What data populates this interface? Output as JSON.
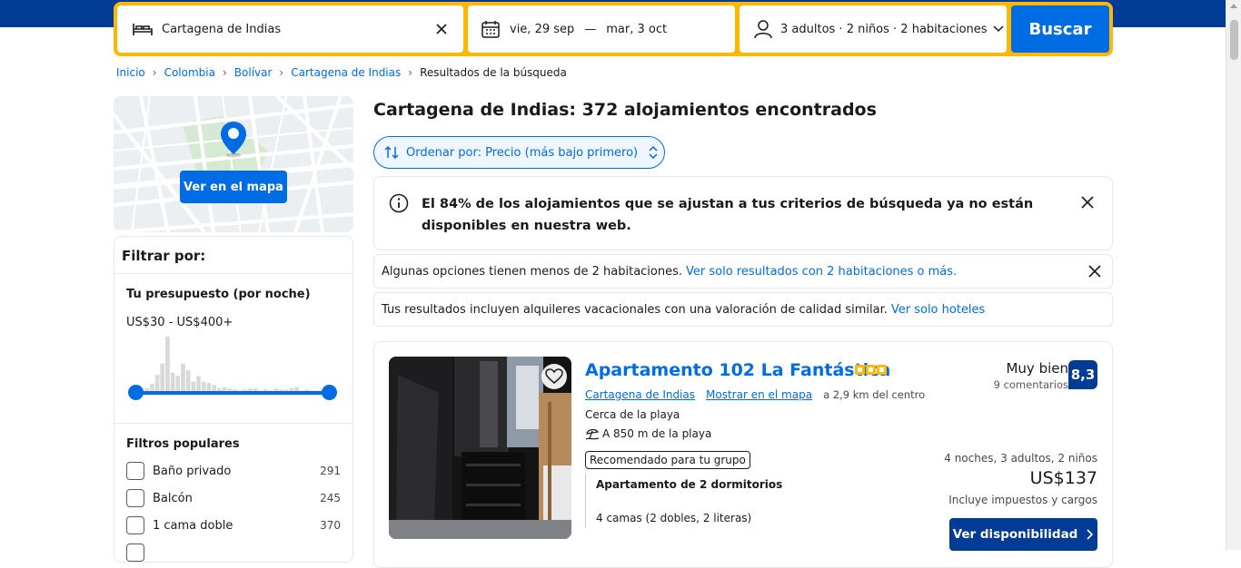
{
  "search": {
    "destination": "Cartagena de Indias",
    "checkin": "vie, 29 sep",
    "date_separator": "—",
    "checkout": "mar, 3 oct",
    "guests": "3 adultos · 2 niños · 2 habitaciones",
    "button_label": "Buscar"
  },
  "breadcrumb": {
    "items": [
      "Inicio",
      "Colombia",
      "Bolívar",
      "Cartagena de Indias"
    ],
    "current": "Resultados de la búsqueda",
    "separator": "›"
  },
  "map": {
    "button_label": "Ver en el mapa"
  },
  "filters": {
    "title": "Filtrar por:",
    "budget_title": "Tu presupuesto (por noche)",
    "budget_range": "US$30 - US$400+",
    "histogram": [
      3,
      3,
      4,
      8,
      16,
      26,
      50,
      18,
      15,
      26,
      20,
      10,
      15,
      10,
      9,
      7,
      4,
      5,
      4,
      3,
      2,
      3,
      4,
      4,
      2,
      3,
      2,
      4,
      3,
      3,
      4,
      5,
      2,
      3,
      2,
      2,
      1,
      2
    ],
    "popular_title": "Filtros populares",
    "options": [
      {
        "label": "Baño privado",
        "count": "291"
      },
      {
        "label": "Balcón",
        "count": "245"
      },
      {
        "label": "1 cama doble",
        "count": "370"
      }
    ]
  },
  "results": {
    "title": "Cartagena de Indias: 372 alojamientos encontrados",
    "sort_label": "Ordenar por: Precio (más bajo primero)",
    "alert": "El 84% de los alojamientos que se ajustan a tus criterios de búsqueda ya no están disponibles en nuestra web.",
    "info1_text": "Algunas opciones tienen menos de 2 habitaciones.",
    "info1_link": "Ver solo resultados con 2 habitaciones o más.",
    "info2_text": "Tus resultados incluyen alquileres vacacionales con una valoración de calidad similar.",
    "info2_link": "Ver solo hoteles"
  },
  "property": {
    "name": "Apartamento 102 La Fantástica",
    "stars": 3,
    "city_link": "Cartagena de Indias",
    "map_link": "Mostrar en el mapa",
    "distance": "a 2,9 km del centro",
    "near": "Cerca de la playa",
    "beach_distance": "A 850 m de la playa",
    "badge": "Recomendado para tu grupo",
    "unit_name": "Apartamento de 2 dormitorios",
    "unit_beds": "4 camas (2 dobles, 2 literas)",
    "review_word": "Muy bien",
    "review_count": "9 comentarios",
    "score": "8,3",
    "stay_info": "4 noches, 3 adultos, 2 niños",
    "price": "US$137",
    "taxes": "Incluye impuestos y cargos",
    "cta": "Ver disponibilidad"
  },
  "colors": {
    "brand_blue": "#003b95",
    "action_blue": "#006ce4",
    "search_border": "#ffb700",
    "star_yellow": "#febb02"
  }
}
